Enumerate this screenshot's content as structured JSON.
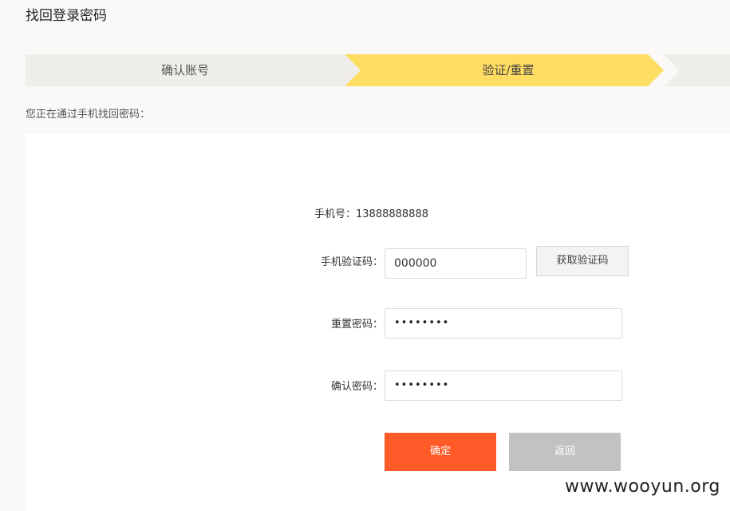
{
  "page": {
    "title": "找回登录密码",
    "hint": "您正在通过手机找回密码："
  },
  "steps": [
    {
      "label": "确认账号",
      "state": "done"
    },
    {
      "label": "验证/重置",
      "state": "active"
    }
  ],
  "colors": {
    "step_inactive": "#efeeea",
    "step_active": "#ffdc62",
    "confirm": "#ff5a28",
    "back": "#c2c2c2"
  },
  "form": {
    "phone_label": "手机号：",
    "phone_value": "13888888888",
    "sms_code_label": "手机验证码：",
    "sms_code_value": "000000",
    "get_code_label": "获取验证码",
    "reset_pw_label": "重置密码：",
    "reset_pw_value": "••••••••",
    "confirm_pw_label": "确认密码：",
    "confirm_pw_value": "••••••••",
    "confirm_button": "确定",
    "back_button": "返回"
  },
  "watermark": "www.wooyun.org"
}
